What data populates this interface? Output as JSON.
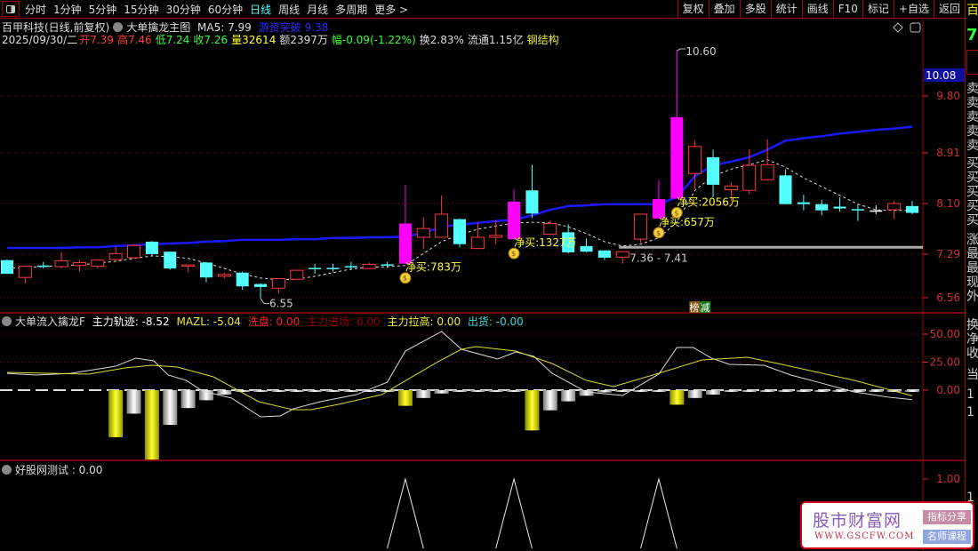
{
  "toolbar": {
    "tabs": [
      "分时",
      "1分钟",
      "5分钟",
      "15分钟",
      "30分钟",
      "60分钟",
      "日线",
      "周线",
      "月线",
      "多周期",
      "更多 >"
    ],
    "active_tab": "日线",
    "buttons": [
      "复权",
      "叠加",
      "多股",
      "统计",
      "画线",
      "F10",
      "标记",
      "+自选",
      "返回"
    ]
  },
  "info": {
    "stock": "百甲科技(日线,前复权)",
    "indicator": "大单擒龙主图",
    "ma5": "MA5: 7.99",
    "breakout_label": "游资突破",
    "breakout_value": "9.38",
    "date": "2025/09/30/二",
    "open": "开7.39",
    "high": "高7.46",
    "low": "低7.24",
    "close": "收7.26",
    "volume": "量32614",
    "amount": "额2397万",
    "change": "幅-0.09(-1.22%)",
    "turnover": "换2.83%",
    "float": "流通1.15亿",
    "sector": "钢结构"
  },
  "indicator_panel": {
    "name": "大单流入擒龙F",
    "main_track": "主力轨迹: -8.52",
    "mazl": "MAZL: -5.04",
    "wash": "洗盘: 0.00",
    "entry": "主力进场: 0.00",
    "pull": "主力拉高: 0.00",
    "ship": "出货: -0.00"
  },
  "test_panel": {
    "name": "好股网测试 : 0.00"
  },
  "colors": {
    "up": "#ff3b3b",
    "down": "#54ffff",
    "signal": "#ff00ff",
    "ma": "#1a1aff",
    "axis": "#d03030",
    "grid": "#8a0010"
  },
  "chart_data": [
    {
      "type": "candlestick",
      "title": "大单擒龙主图",
      "y_ticks": [
        6.56,
        7.29,
        8.1,
        8.91,
        9.8
      ],
      "current_marker": "10.08",
      "ohlc": [
        [
          7.19,
          7.2,
          6.96,
          6.96
        ],
        [
          6.9,
          7.09,
          6.8,
          7.09
        ],
        [
          7.1,
          7.16,
          7.05,
          7.08
        ],
        [
          7.08,
          7.32,
          7.05,
          7.18
        ],
        [
          7.1,
          7.19,
          7.0,
          7.15
        ],
        [
          7.09,
          7.2,
          7.05,
          7.19
        ],
        [
          7.2,
          7.42,
          7.18,
          7.3
        ],
        [
          7.23,
          7.45,
          7.22,
          7.43
        ],
        [
          7.49,
          7.5,
          7.26,
          7.29
        ],
        [
          7.33,
          7.33,
          7.03,
          7.05
        ],
        [
          7.09,
          7.11,
          7.0,
          7.11
        ],
        [
          7.15,
          7.16,
          6.82,
          6.9
        ],
        [
          6.92,
          6.98,
          6.88,
          6.95
        ],
        [
          6.98,
          7.0,
          6.69,
          6.75
        ],
        [
          6.79,
          6.8,
          6.55,
          6.74
        ],
        [
          6.72,
          6.88,
          6.63,
          6.88
        ],
        [
          6.87,
          7.03,
          6.86,
          7.02
        ],
        [
          7.06,
          7.13,
          6.96,
          7.04
        ],
        [
          7.06,
          7.13,
          6.99,
          7.05
        ],
        [
          7.09,
          7.16,
          7.02,
          7.08
        ],
        [
          7.05,
          7.15,
          7.05,
          7.12
        ],
        [
          7.12,
          7.16,
          7.06,
          7.11
        ],
        [
          7.13,
          8.4,
          7.13,
          7.78
        ],
        [
          7.56,
          7.88,
          7.37,
          7.7
        ],
        [
          7.56,
          8.23,
          7.56,
          7.93
        ],
        [
          7.85,
          7.86,
          7.4,
          7.45
        ],
        [
          7.38,
          7.79,
          7.38,
          7.56
        ],
        [
          7.56,
          7.83,
          7.45,
          7.59
        ],
        [
          7.53,
          8.33,
          7.53,
          8.13
        ],
        [
          8.31,
          8.72,
          7.87,
          7.94
        ],
        [
          7.61,
          7.83,
          7.6,
          7.78
        ],
        [
          7.64,
          7.77,
          7.3,
          7.32
        ],
        [
          7.42,
          7.54,
          7.32,
          7.33
        ],
        [
          7.35,
          7.35,
          7.19,
          7.23
        ],
        [
          7.24,
          7.34,
          7.13,
          7.33
        ],
        [
          7.53,
          7.93,
          7.47,
          7.93
        ],
        [
          7.86,
          8.48,
          7.86,
          8.17
        ],
        [
          8.18,
          10.6,
          8.18,
          9.47
        ],
        [
          8.58,
          9.11,
          8.34,
          9.01
        ],
        [
          8.84,
          8.96,
          8.2,
          8.4
        ],
        [
          8.32,
          8.44,
          8.14,
          8.38
        ],
        [
          8.31,
          8.97,
          8.25,
          8.71
        ],
        [
          8.48,
          9.12,
          8.48,
          8.72
        ],
        [
          8.55,
          8.65,
          8.09,
          8.09
        ],
        [
          8.12,
          8.24,
          7.99,
          8.09
        ],
        [
          8.09,
          8.16,
          7.91,
          7.99
        ],
        [
          8.05,
          8.2,
          7.97,
          8.02
        ],
        [
          8.01,
          8.09,
          7.82,
          8.0
        ],
        [
          7.99,
          8.07,
          7.93,
          7.99
        ],
        [
          8.0,
          8.14,
          7.85,
          8.1
        ],
        [
          8.06,
          8.14,
          7.93,
          7.95
        ]
      ],
      "signal_candles": [
        23,
        29,
        37,
        38
      ],
      "trend_line": [
        7.39,
        7.39,
        7.39,
        7.39,
        7.4,
        7.4,
        7.42,
        7.43,
        7.45,
        7.46,
        7.47,
        7.49,
        7.5,
        7.52,
        7.52,
        7.52,
        7.53,
        7.53,
        7.55,
        7.55,
        7.56,
        7.56,
        7.57,
        7.63,
        7.73,
        7.76,
        7.79,
        7.82,
        7.84,
        7.91,
        8.0,
        8.06,
        8.07,
        8.09,
        8.09,
        8.09,
        8.09,
        8.2,
        8.54,
        8.71,
        8.77,
        8.84,
        8.96,
        9.1,
        9.14,
        9.17,
        9.21,
        9.24,
        9.27,
        9.29,
        9.32
      ],
      "ma_dashed": [
        7.05,
        7.07,
        7.08,
        7.1,
        7.11,
        7.14,
        7.17,
        7.22,
        7.26,
        7.25,
        7.22,
        7.14,
        7.05,
        6.96,
        6.89,
        6.86,
        6.87,
        6.92,
        6.98,
        7.04,
        7.07,
        7.08,
        7.1,
        7.3,
        7.49,
        7.6,
        7.69,
        7.74,
        7.79,
        7.8,
        7.79,
        7.73,
        7.62,
        7.49,
        7.42,
        7.45,
        7.55,
        7.8,
        8.31,
        8.54,
        8.65,
        8.72,
        8.8,
        8.68,
        8.51,
        8.37,
        8.23,
        8.09,
        8.0,
        7.99,
        7.99
      ],
      "support_level": {
        "price": 7.4,
        "from_candle": 35,
        "label": "7.36 - 7.41"
      },
      "extremes": [
        {
          "candle": 38,
          "label": "10.60",
          "price": 10.6
        },
        {
          "candle": 15,
          "label": "6.55",
          "price": 6.55
        }
      ],
      "net_buy": [
        {
          "candle": 23,
          "label": "净买:783万"
        },
        {
          "candle": 29,
          "label": "净买:1327万"
        },
        {
          "candle": 37,
          "label": "净买:657万"
        },
        {
          "candle": 38,
          "label": "净买:2056万"
        }
      ],
      "tag": {
        "candle": 38,
        "left": "榜",
        "right": "减"
      }
    },
    {
      "type": "bar+line",
      "title": "大单流入擒龙F",
      "y_ticks": [
        0,
        25,
        50
      ],
      "bars": [
        null,
        null,
        null,
        null,
        null,
        null,
        -42,
        -21,
        -62,
        -31,
        -16,
        -9,
        -4,
        -0.8,
        -0.8,
        -0.8,
        -0.8,
        -0.8,
        -0.8,
        -0.8,
        -0.8,
        -0.8,
        -14,
        -7,
        -3,
        -1,
        -1,
        -1,
        -1,
        -36,
        -18,
        -10,
        -5,
        -2,
        -0.8,
        -0.8,
        -0.8,
        -13,
        -7,
        -4,
        -0.8,
        -0.8,
        -0.8,
        -0.8,
        -0.8,
        -0.8,
        -0.8,
        -0.8,
        -0.8,
        -0.8,
        -0.8
      ],
      "gold_bars": [
        7,
        9,
        23,
        30,
        38
      ],
      "main_track": [
        [
          1,
          15
        ],
        [
          2.6,
          13.5
        ],
        [
          4.5,
          15
        ],
        [
          7,
          21.4
        ],
        [
          8.1,
          28.6
        ],
        [
          9.1,
          26.2
        ],
        [
          9.9,
          13.5
        ],
        [
          10.9,
          8.7
        ],
        [
          11.8,
          -0.8
        ],
        [
          13.4,
          -7.1
        ],
        [
          15,
          -23.8
        ],
        [
          16.1,
          -23
        ],
        [
          16.8,
          -16.7
        ],
        [
          18.3,
          -10.3
        ],
        [
          20.3,
          -4
        ],
        [
          22,
          7.1
        ],
        [
          23,
          34.9
        ],
        [
          25,
          52.4
        ],
        [
          26.1,
          36.5
        ],
        [
          28.1,
          27.8
        ],
        [
          29.1,
          34.1
        ],
        [
          30.1,
          30.2
        ],
        [
          31.1,
          15.1
        ],
        [
          33,
          -1.6
        ],
        [
          35,
          -4.8
        ],
        [
          37,
          14.3
        ],
        [
          38,
          38.1
        ],
        [
          38.9,
          38.1
        ],
        [
          39.9,
          28.6
        ],
        [
          40.9,
          23
        ],
        [
          42.8,
          22.2
        ],
        [
          44.3,
          13.5
        ],
        [
          45.8,
          7.1
        ],
        [
          47.8,
          -1.6
        ],
        [
          49.7,
          -6.3
        ],
        [
          51,
          -8.52
        ]
      ],
      "mazl": [
        [
          1,
          15.9
        ],
        [
          5.5,
          14.3
        ],
        [
          7.5,
          19.8
        ],
        [
          9,
          22.2
        ],
        [
          10.4,
          20.6
        ],
        [
          12.4,
          11.9
        ],
        [
          14.9,
          -10.3
        ],
        [
          16.8,
          -17.5
        ],
        [
          17.8,
          -17.5
        ],
        [
          19.3,
          -12.7
        ],
        [
          21.7,
          -4
        ],
        [
          23.2,
          10.3
        ],
        [
          24.9,
          26.2
        ],
        [
          26.1,
          36.5
        ],
        [
          26.9,
          38.9
        ],
        [
          29.1,
          34.9
        ],
        [
          31.1,
          23.8
        ],
        [
          33,
          8.7
        ],
        [
          34.5,
          3.2
        ],
        [
          37,
          15.1
        ],
        [
          39.4,
          27
        ],
        [
          41.9,
          29.4
        ],
        [
          43.8,
          23
        ],
        [
          47.8,
          8.7
        ],
        [
          51,
          -5.04
        ]
      ]
    },
    {
      "type": "line",
      "title": "好股网测试",
      "y_ticks": [
        1.0
      ],
      "peaks": [
        23,
        29,
        37
      ]
    }
  ],
  "sidebar": {
    "top": "百",
    "price": "7",
    "chars": [
      "卖",
      "卖",
      "卖",
      "卖",
      "卖",
      "买",
      "买",
      "买",
      "买",
      "买",
      "涨",
      "最",
      "最",
      "现",
      "外",
      "换",
      "净",
      "收",
      "当",
      "1",
      "1",
      "1"
    ]
  },
  "watermark": {
    "title": "股市财富网",
    "url": "WWW.GSCFW.COM",
    "btn1": "指标分享",
    "btn2": "名师课程"
  }
}
